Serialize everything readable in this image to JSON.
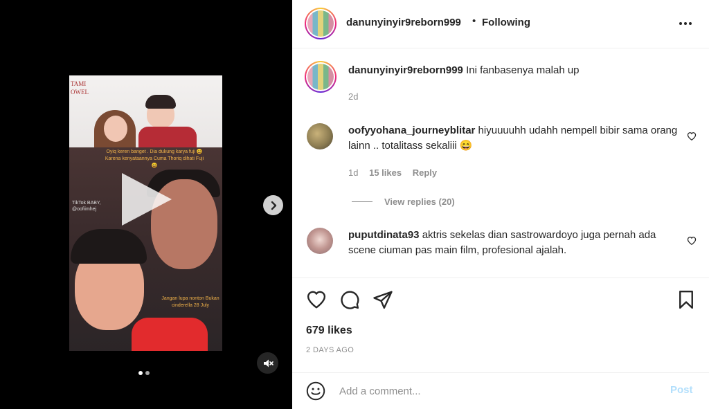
{
  "media": {
    "wall_text_1": "TAMI",
    "wall_text_2": "OWEL",
    "caption_top": "Oyiq keren banget . Dia dukung karya fuji 😄 Karena kenyataannya Cuma Thoriq dihati Fuji 😄",
    "caption_bottom": "Jangan lupa nonton Bukan cinderella 28 July",
    "watermark_logo": "TikTok",
    "watermark_text": "BABY,",
    "watermark_handle": "@oofiimhej",
    "carousel_index": 1,
    "carousel_count": 2
  },
  "header": {
    "username": "danunyinyir9reborn999",
    "separator": "•",
    "follow_label": "Following"
  },
  "caption": {
    "username": "danunyinyir9reborn999",
    "text": "Ini fanbasenya malah up",
    "age": "2d"
  },
  "comments": [
    {
      "username": "oofyyohana_journeyblitar",
      "text": "hiyuuuuhh udahh nempell bibir sama orang lainn .. totalitass sekaliii 😄",
      "age": "1d",
      "likes": "15 likes",
      "reply_label": "Reply",
      "view_replies": "View replies (20)"
    },
    {
      "username": "puputdinata93",
      "text": "aktris sekelas dian sastrowardoyo juga pernah ada scene ciuman pas main film, profesional ajalah."
    }
  ],
  "post": {
    "likes": "679 likes",
    "date": "2 DAYS AGO"
  },
  "composer": {
    "placeholder": "Add a comment...",
    "post_label": "Post"
  },
  "colors": {
    "link_blue_disabled": "#b2dffc",
    "text_primary": "#262626",
    "text_secondary": "#8e8e8e"
  }
}
